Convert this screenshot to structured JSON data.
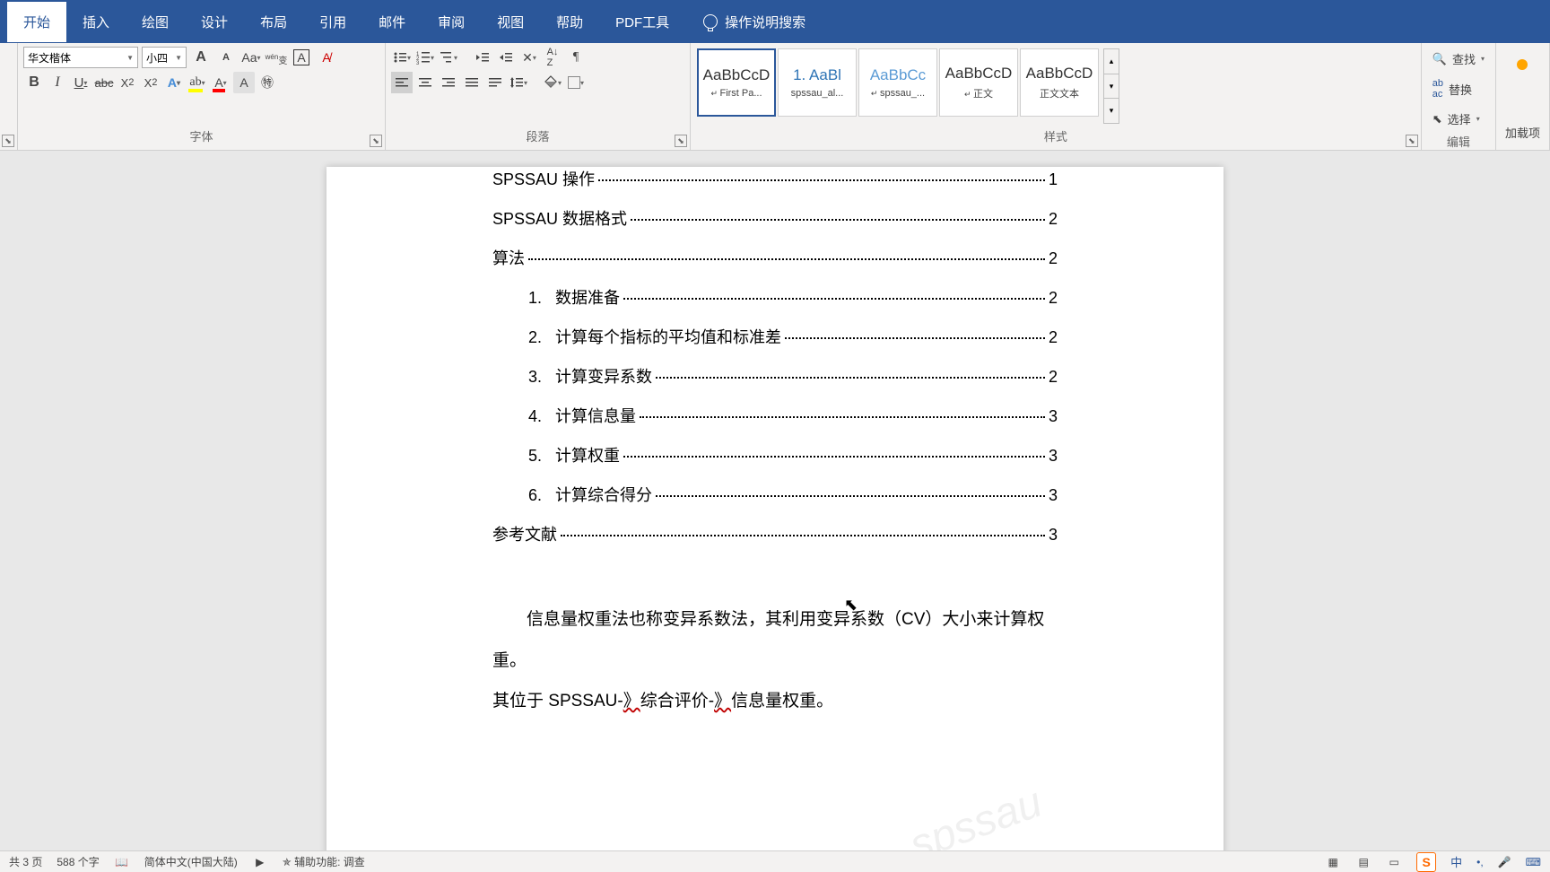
{
  "tabs": [
    "开始",
    "插入",
    "绘图",
    "设计",
    "布局",
    "引用",
    "邮件",
    "审阅",
    "视图",
    "帮助",
    "PDF工具"
  ],
  "active_tab": 0,
  "tell_me": "操作说明搜索",
  "font": {
    "name": "华文楷体",
    "size": "小四",
    "group_label": "字体"
  },
  "paragraph": {
    "group_label": "段落"
  },
  "styles": {
    "group_label": "样式",
    "items": [
      {
        "preview": "AaBbCcD",
        "name": "First Pa...",
        "link": true,
        "sel": true,
        "cls": ""
      },
      {
        "preview": "1. AaBl",
        "name": "spssau_al...",
        "link": false,
        "sel": false,
        "cls": "blue"
      },
      {
        "preview": "AaBbCc",
        "name": "spssau_...",
        "link": true,
        "sel": false,
        "cls": "lblue"
      },
      {
        "preview": "AaBbCcD",
        "name": "正文",
        "link": true,
        "sel": false,
        "cls": ""
      },
      {
        "preview": "AaBbCcD",
        "name": "正文文本",
        "link": false,
        "sel": false,
        "cls": ""
      }
    ]
  },
  "editing": {
    "group_label": "编辑",
    "find": "查找",
    "replace": "替换",
    "select": "选择"
  },
  "addin": {
    "label": "加载项"
  },
  "toc": [
    {
      "text": "SPSSAU 操作",
      "page": "1",
      "indent": false,
      "num": ""
    },
    {
      "text": "SPSSAU 数据格式",
      "page": "2",
      "indent": false,
      "num": ""
    },
    {
      "text": "算法",
      "page": "2",
      "indent": false,
      "num": ""
    },
    {
      "text": "数据准备",
      "page": "2",
      "indent": true,
      "num": "1."
    },
    {
      "text": "计算每个指标的平均值和标准差",
      "page": "2",
      "indent": true,
      "num": "2."
    },
    {
      "text": "计算变异系数",
      "page": "2",
      "indent": true,
      "num": "3."
    },
    {
      "text": "计算信息量",
      "page": "3",
      "indent": true,
      "num": "4."
    },
    {
      "text": "计算权重",
      "page": "3",
      "indent": true,
      "num": "5."
    },
    {
      "text": "计算综合得分",
      "page": "3",
      "indent": true,
      "num": "6."
    },
    {
      "text": "参考文献",
      "page": "3",
      "indent": false,
      "num": ""
    }
  ],
  "body": {
    "p1_a": "信息量权重法也称变异系数法，其利用变异系数（CV）大小来计算权重。",
    "p2_a": "其位于 SPSSAU-",
    "p2_b": "》",
    "p2_c": "综合评价-",
    "p2_d": "》",
    "p2_e": "信息量权重。"
  },
  "watermark": "spssau",
  "status": {
    "pages": "共 3 页",
    "words": "588 个字",
    "lang": "简体中文(中国大陆)",
    "a11y": "辅助功能: 调查",
    "ime": "中"
  }
}
